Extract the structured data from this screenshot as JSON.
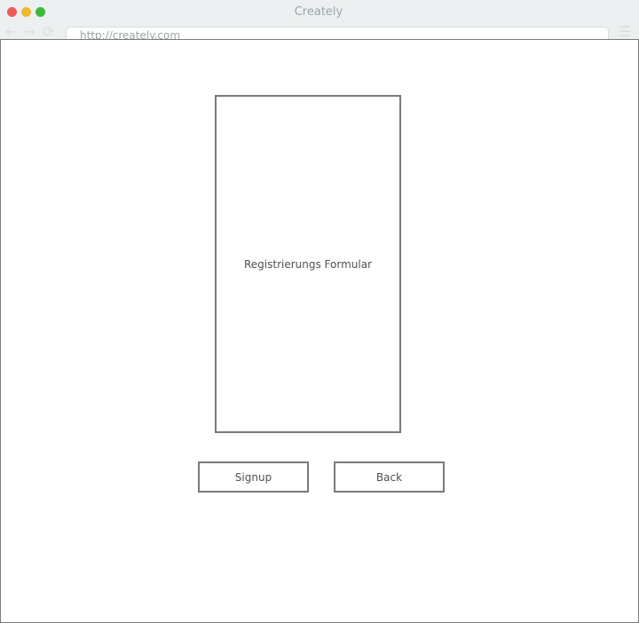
{
  "window": {
    "title": "Creately"
  },
  "browser": {
    "url": "http://creately.com",
    "icons": [
      "back-arrow-icon",
      "forward-arrow-icon",
      "reload-icon",
      "menu-icon"
    ]
  },
  "form": {
    "label": "Registrierungs Formular"
  },
  "buttons": {
    "signup": "Signup",
    "back": "Back"
  }
}
